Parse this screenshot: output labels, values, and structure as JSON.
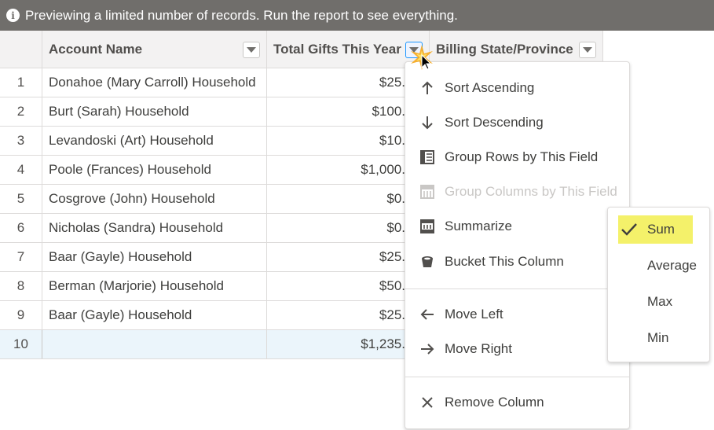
{
  "notice": {
    "text": "Previewing a limited number of records. Run the report to see everything."
  },
  "columns": [
    {
      "label": "Account Name"
    },
    {
      "label": "Total Gifts This Year"
    },
    {
      "label": "Billing State/Province"
    }
  ],
  "rows": [
    {
      "num": "1",
      "name": "Donahoe (Mary Carroll) Household",
      "gifts": "$25."
    },
    {
      "num": "2",
      "name": "Burt (Sarah) Household",
      "gifts": "$100."
    },
    {
      "num": "3",
      "name": "Levandoski (Art) Household",
      "gifts": "$10."
    },
    {
      "num": "4",
      "name": "Poole (Frances) Household",
      "gifts": "$1,000."
    },
    {
      "num": "5",
      "name": "Cosgrove (John) Household",
      "gifts": "$0."
    },
    {
      "num": "6",
      "name": "Nicholas (Sandra) Household",
      "gifts": "$0."
    },
    {
      "num": "7",
      "name": "Baar (Gayle) Household",
      "gifts": "$25."
    },
    {
      "num": "8",
      "name": "Berman (Marjorie) Household",
      "gifts": "$50."
    },
    {
      "num": "9",
      "name": "Baar (Gayle) Household",
      "gifts": "$25."
    }
  ],
  "total_row": {
    "num": "10",
    "name": "",
    "gifts": "$1,235."
  },
  "menu": {
    "sort_ascending": "Sort Ascending",
    "sort_descending": "Sort Descending",
    "group_rows": "Group Rows by This Field",
    "group_columns": "Group Columns by This Field",
    "summarize": "Summarize",
    "bucket": "Bucket This Column",
    "move_left": "Move Left",
    "move_right": "Move Right",
    "remove_column": "Remove Column"
  },
  "submenu": {
    "sum": "Sum",
    "average": "Average",
    "max": "Max",
    "min": "Min",
    "selected": "Sum"
  },
  "colors": {
    "header_bar": "#706e6b",
    "highlight": "#f4f16a",
    "total_row_bg": "#ebf5fb"
  }
}
